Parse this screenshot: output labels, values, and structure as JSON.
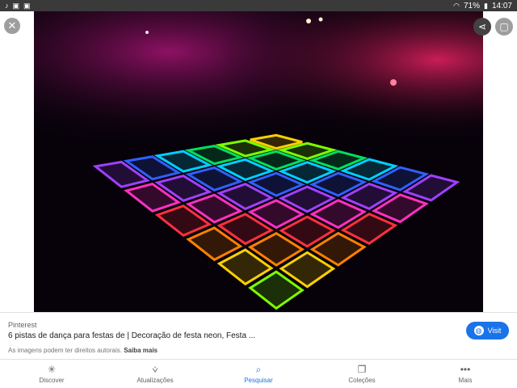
{
  "status_bar": {
    "battery": "71%",
    "time": "14:07",
    "left_icons": [
      "tiktok-icon",
      "image-icon",
      "image-icon"
    ],
    "right_icons": [
      "wifi-icon",
      "battery-icon"
    ]
  },
  "viewer": {
    "close_icon": "close-icon",
    "share_icon": "share-icon",
    "more_icon": "more-icon",
    "image_description_colors": {
      "background": "#07020a",
      "ambient": "#d01a8a"
    }
  },
  "info": {
    "source": "Pinterest",
    "title": "6 pistas de dança para festas de | Decoração de festa neon, Festa ...",
    "rights_text": "As imagens podem ter direitos autorais.",
    "learn_more": "Saiba mais",
    "visit_label": "Visit"
  },
  "nav": {
    "items": [
      {
        "label": "Discover",
        "icon": "asterisk-icon"
      },
      {
        "label": "Atualizações",
        "icon": "updates-icon"
      },
      {
        "label": "Pesquisar",
        "icon": "search-icon"
      },
      {
        "label": "Coleções",
        "icon": "collections-icon"
      },
      {
        "label": "Mais",
        "icon": "more-dots-icon"
      }
    ],
    "active_index": 2
  },
  "colors": {
    "accent": "#1a73e8",
    "text_primary": "#202124",
    "text_secondary": "#5f6368"
  }
}
